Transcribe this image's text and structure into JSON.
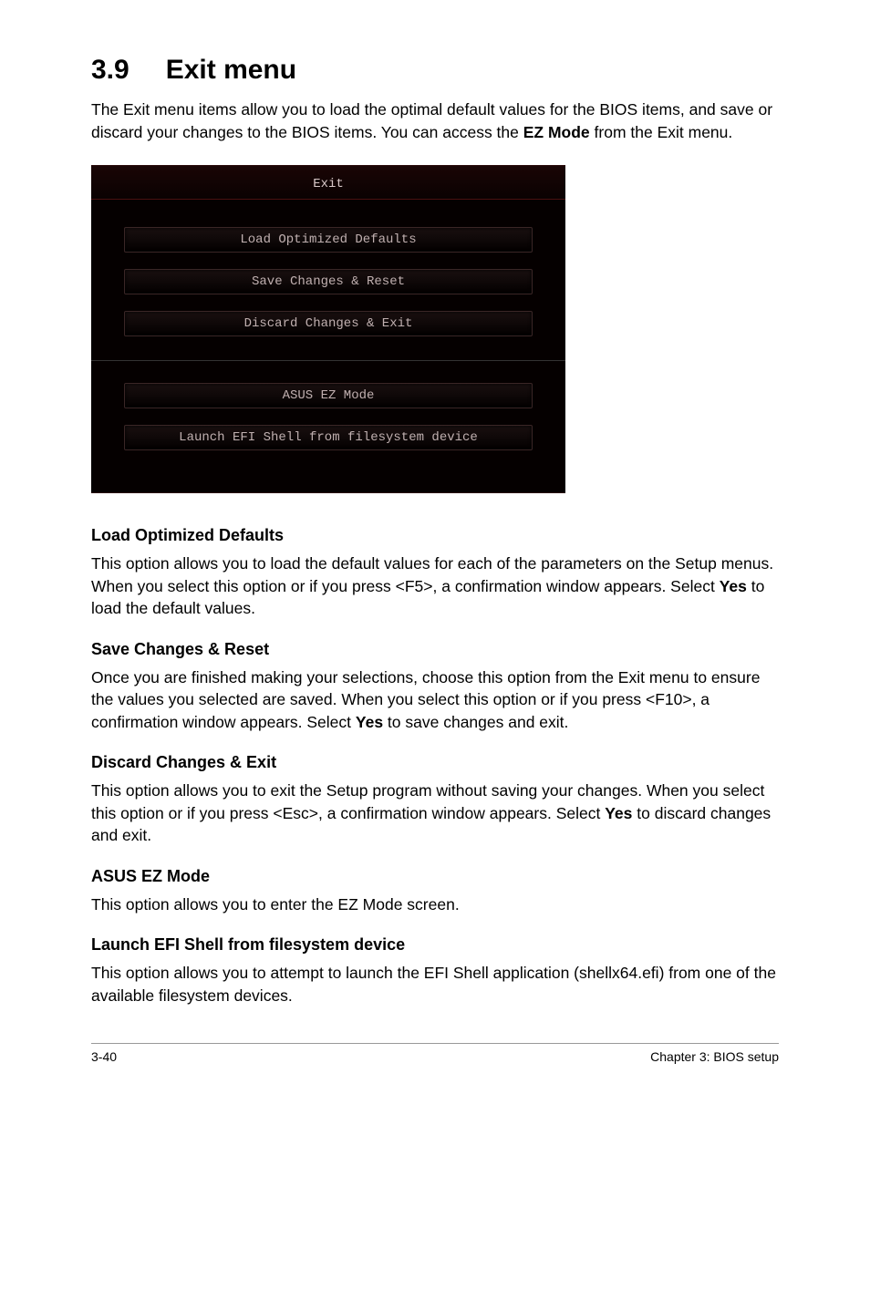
{
  "heading": {
    "number": "3.9",
    "title": "Exit menu"
  },
  "intro": {
    "prefix": "The Exit menu items allow you to load the optimal default values for the BIOS items, and save or discard your changes to the BIOS items. You can access the ",
    "bold": "EZ Mode",
    "suffix": " from the Exit menu."
  },
  "bios": {
    "title": "Exit",
    "buttons": {
      "load": "Load Optimized Defaults",
      "save": "Save Changes & Reset",
      "discard": "Discard Changes & Exit",
      "ez": "ASUS EZ Mode",
      "efi": "Launch EFI Shell from filesystem device"
    }
  },
  "sections": {
    "load": {
      "title": "Load Optimized Defaults",
      "pre": "This option allows you to load the default values for each of the parameters on the Setup menus. When you select this option or if you press <F5>, a confirmation window appears. Select ",
      "bold": "Yes",
      "post": " to load the default values."
    },
    "save": {
      "title": "Save Changes & Reset",
      "pre": "Once you are finished making your selections, choose this option from the Exit menu to ensure the values you selected are saved. When you select this option or if you press <F10>, a confirmation window appears. Select ",
      "bold": "Yes",
      "post": " to save changes and exit."
    },
    "discard": {
      "title": "Discard Changes & Exit",
      "pre": "This option allows you to exit the Setup program without saving your changes. When you select this option or if you press <Esc>, a confirmation window appears. Select ",
      "bold": "Yes",
      "post": " to discard changes and exit."
    },
    "ez": {
      "title": "ASUS EZ Mode",
      "text": "This option allows you to enter the EZ Mode screen."
    },
    "efi": {
      "title": "Launch EFI Shell from filesystem device",
      "text": "This option allows you to attempt to launch the EFI Shell application (shellx64.efi) from one of the available filesystem devices."
    }
  },
  "footer": {
    "left": "3-40",
    "right": "Chapter 3: BIOS setup"
  }
}
